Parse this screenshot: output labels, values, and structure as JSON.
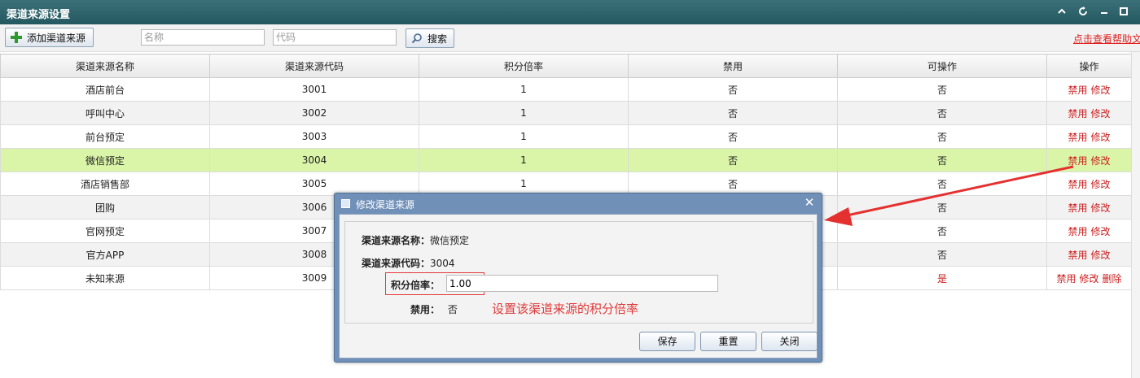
{
  "window": {
    "title": "渠道来源设置"
  },
  "toolbar": {
    "add_label": "添加渠道来源",
    "name_placeholder": "名称",
    "code_placeholder": "代码",
    "search_label": "搜索",
    "help_link": "点击查看帮助文"
  },
  "table": {
    "headers": [
      "渠道来源名称",
      "渠道来源代码",
      "积分倍率",
      "禁用",
      "可操作",
      "操作"
    ],
    "rows": [
      {
        "name": "酒店前台",
        "code": "3001",
        "rate": "1",
        "disabled": "否",
        "operable": "否"
      },
      {
        "name": "呼叫中心",
        "code": "3002",
        "rate": "1",
        "disabled": "否",
        "operable": "否"
      },
      {
        "name": "前台预定",
        "code": "3003",
        "rate": "1",
        "disabled": "否",
        "operable": "否"
      },
      {
        "name": "微信预定",
        "code": "3004",
        "rate": "1",
        "disabled": "否",
        "operable": "否"
      },
      {
        "name": "酒店销售部",
        "code": "3005",
        "rate": "1",
        "disabled": "否",
        "operable": "否"
      },
      {
        "name": "团购",
        "code": "3006",
        "rate": "",
        "disabled": "",
        "operable": "否"
      },
      {
        "name": "官网预定",
        "code": "3007",
        "rate": "",
        "disabled": "",
        "operable": "否"
      },
      {
        "name": "官方APP",
        "code": "3008",
        "rate": "",
        "disabled": "",
        "operable": "否"
      },
      {
        "name": "未知来源",
        "code": "3009",
        "rate": "",
        "disabled": "",
        "operable": "是"
      }
    ],
    "actions": {
      "disable": "禁用",
      "edit": "修改",
      "delete": "删除"
    },
    "selected_row": 3
  },
  "modal": {
    "title": "修改渠道来源",
    "close_glyph": "✕",
    "name_label": "渠道来源名称：",
    "name_value": "微信预定",
    "code_label": "渠道来源代码：",
    "code_value": "3004",
    "rate_label": "积分倍率：",
    "rate_value": "1.00",
    "disabled_label": "禁用：",
    "disabled_value": "否",
    "annotation": "设置该渠道来源的积分倍率",
    "save_label": "保存",
    "reset_label": "重置",
    "close_label": "关闭"
  },
  "colors": {
    "titlebar": "#2e6369",
    "selected_row": "#daf5a8",
    "action_red": "#cc1f1f",
    "annotation_red": "#e03a3a",
    "modal_frame": "#7090b8"
  }
}
